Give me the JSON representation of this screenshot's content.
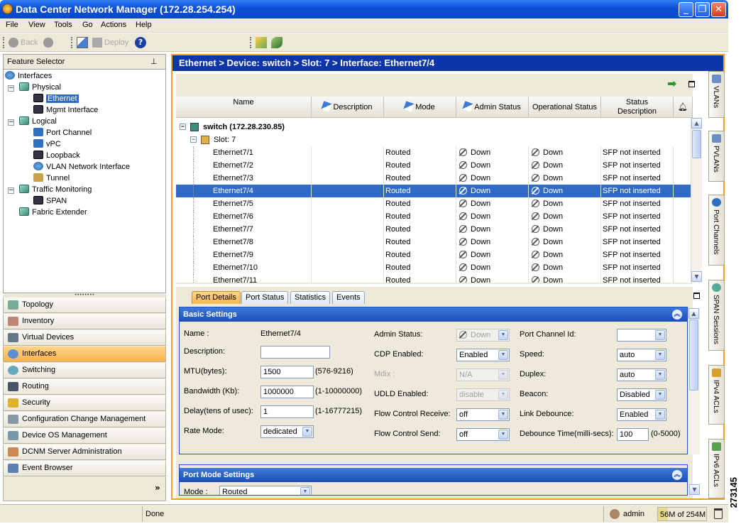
{
  "window": {
    "title": "Data Center Network Manager (172.28.254.254)"
  },
  "menu": [
    "File",
    "View",
    "Tools",
    "Go",
    "Actions",
    "Help"
  ],
  "toolbar": {
    "back": "Back",
    "deploy": "Deploy"
  },
  "feature_selector": {
    "title": "Feature Selector",
    "tree": {
      "interfaces": "Interfaces",
      "physical": "Physical",
      "ethernet": "Ethernet",
      "mgmt": "Mgmt Interface",
      "logical": "Logical",
      "port_channel": "Port Channel",
      "vpc": "vPC",
      "loopback": "Loopback",
      "vlan_if": "VLAN Network Interface",
      "tunnel": "Tunnel",
      "traffic": "Traffic Monitoring",
      "span": "SPAN",
      "fex": "Fabric Extender"
    }
  },
  "nav": [
    "Topology",
    "Inventory",
    "Virtual Devices",
    "Interfaces",
    "Switching",
    "Routing",
    "Security",
    "Configuration Change Management",
    "Device OS Management",
    "DCNM Server Administration",
    "Event Browser"
  ],
  "breadcrumb": "Ethernet > Device: switch > Slot: 7 > Interface: Ethernet7/4",
  "grid": {
    "headers": {
      "name": "Name",
      "description": "Description",
      "mode": "Mode",
      "admin": "Admin Status",
      "oper": "Operational Status",
      "status1": "Status",
      "status2": "Description"
    },
    "device": "switch (172.28.230.85)",
    "slot": "Slot: 7",
    "rows": [
      {
        "name": "Ethernet7/1",
        "mode": "Routed",
        "admin": "Down",
        "oper": "Down",
        "desc": "SFP not inserted"
      },
      {
        "name": "Ethernet7/2",
        "mode": "Routed",
        "admin": "Down",
        "oper": "Down",
        "desc": "SFP not inserted"
      },
      {
        "name": "Ethernet7/3",
        "mode": "Routed",
        "admin": "Down",
        "oper": "Down",
        "desc": "SFP not inserted"
      },
      {
        "name": "Ethernet7/4",
        "mode": "Routed",
        "admin": "Down",
        "oper": "Down",
        "desc": "SFP not inserted"
      },
      {
        "name": "Ethernet7/5",
        "mode": "Routed",
        "admin": "Down",
        "oper": "Down",
        "desc": "SFP not inserted"
      },
      {
        "name": "Ethernet7/6",
        "mode": "Routed",
        "admin": "Down",
        "oper": "Down",
        "desc": "SFP not inserted"
      },
      {
        "name": "Ethernet7/7",
        "mode": "Routed",
        "admin": "Down",
        "oper": "Down",
        "desc": "SFP not inserted"
      },
      {
        "name": "Ethernet7/8",
        "mode": "Routed",
        "admin": "Down",
        "oper": "Down",
        "desc": "SFP not inserted"
      },
      {
        "name": "Ethernet7/9",
        "mode": "Routed",
        "admin": "Down",
        "oper": "Down",
        "desc": "SFP not inserted"
      },
      {
        "name": "Ethernet7/10",
        "mode": "Routed",
        "admin": "Down",
        "oper": "Down",
        "desc": "SFP not inserted"
      },
      {
        "name": "Ethernet7/11",
        "mode": "Routed",
        "admin": "Down",
        "oper": "Down",
        "desc": "SFP not inserted"
      }
    ]
  },
  "tabs": [
    "Port Details",
    "Port Status",
    "Statistics",
    "Events"
  ],
  "basic": {
    "title": "Basic Settings",
    "name_label": "Name :",
    "name_value": "Ethernet7/4",
    "desc_label": "Description:",
    "desc_value": "",
    "mtu_label": "MTU(bytes):",
    "mtu_value": "1500",
    "mtu_range": "(576-9216)",
    "bw_label": "Bandwidth (Kb):",
    "bw_value": "1000000",
    "bw_range": "(1-10000000)",
    "delay_label": "Delay(tens of usec):",
    "delay_value": "1",
    "delay_range": "(1-16777215)",
    "rate_label": "Rate Mode:",
    "rate_value": "dedicated",
    "admin_label": "Admin Status:",
    "admin_value": "Down",
    "cdp_label": "CDP Enabled:",
    "cdp_value": "Enabled",
    "mdix_label": "Mdix :",
    "mdix_value": "N/A",
    "udld_label": "UDLD Enabled:",
    "udld_value": "disable",
    "fcr_label": "Flow Control Receive:",
    "fcr_value": "off",
    "fcs_label": "Flow Control Send:",
    "fcs_value": "off",
    "pc_label": "Port Channel Id:",
    "pc_value": "",
    "speed_label": "Speed:",
    "speed_value": "auto",
    "duplex_label": "Duplex:",
    "duplex_value": "auto",
    "beacon_label": "Beacon:",
    "beacon_value": "Disabled",
    "ld_label": "Link Debounce:",
    "ld_value": "Enabled",
    "dt_label": "Debounce Time(milli-secs):",
    "dt_value": "100",
    "dt_range": "(0-5000)"
  },
  "port_mode": {
    "title": "Port Mode Settings",
    "mode_label": "Mode :",
    "mode_value": "Routed"
  },
  "side_tabs": [
    "VLANs",
    "PVLANs",
    "Port Channels",
    "SPAN Sessions",
    "IPv4 ACLs",
    "IPv6 ACLs"
  ],
  "status": {
    "text": "Done",
    "user": "admin",
    "memory": "56M of 254M"
  },
  "figure_id": "273145"
}
